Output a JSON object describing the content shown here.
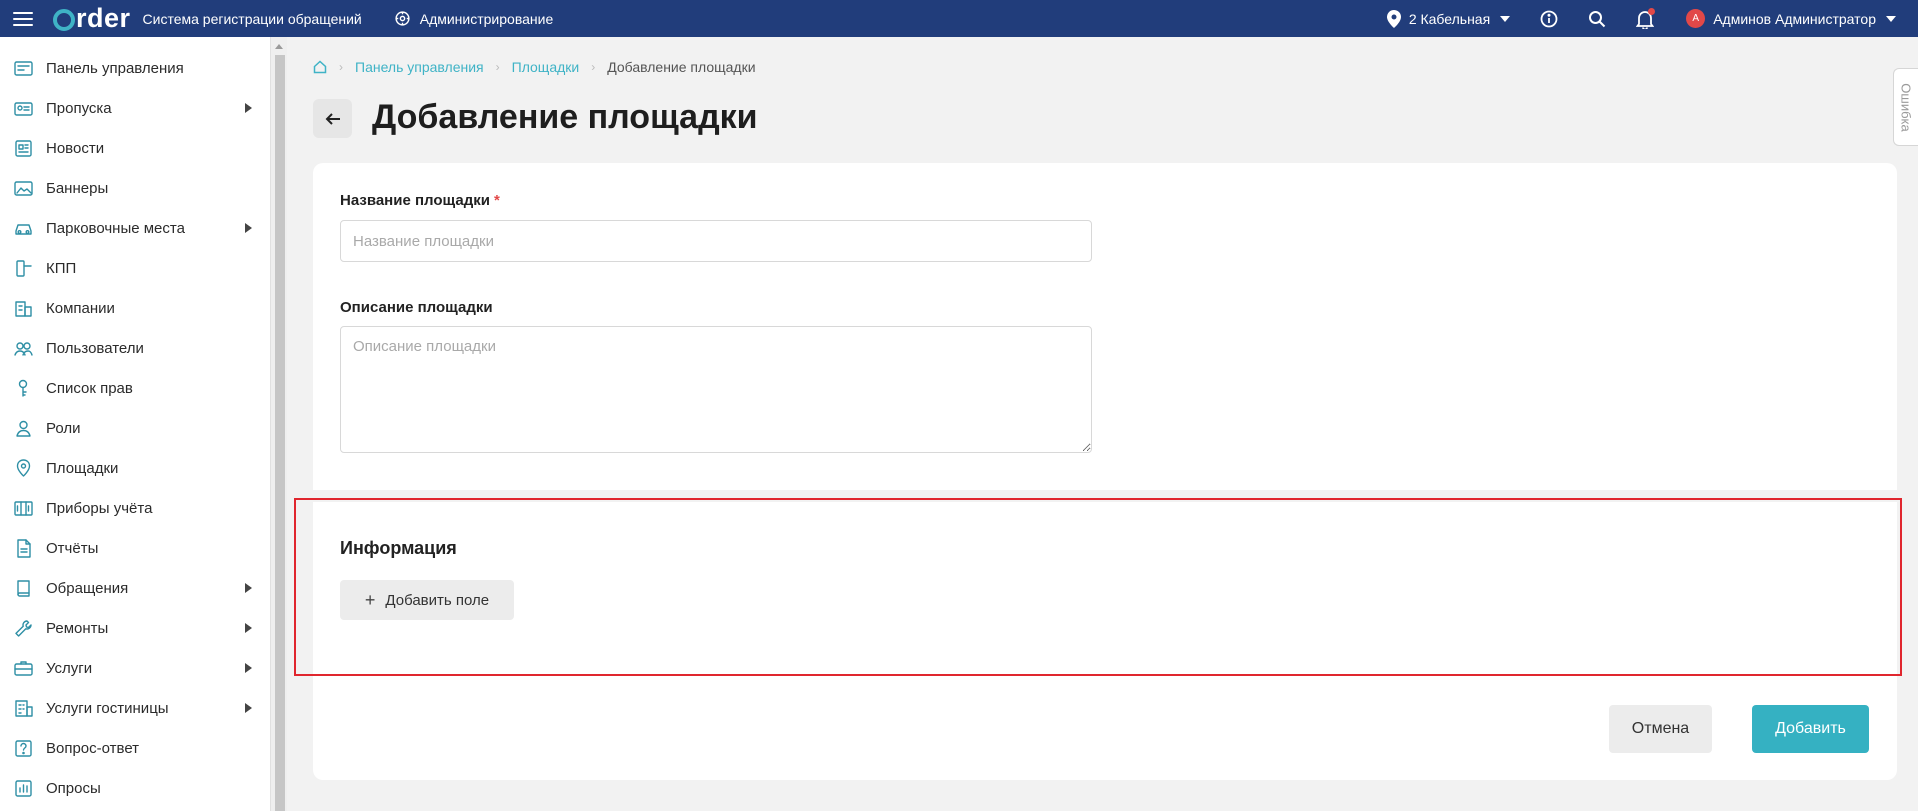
{
  "header": {
    "logo_text": "rder",
    "app_title": "Система регистрации обращений",
    "admin_label": "Администрирование",
    "location": "2 Кабельная",
    "user_name": "Админов Администратор",
    "avatar_letter": "А"
  },
  "sidebar": {
    "items": [
      {
        "label": "Панель управления",
        "icon": "dashboard-icon",
        "submenu": false
      },
      {
        "label": "Пропуска",
        "icon": "pass-card-icon",
        "submenu": true
      },
      {
        "label": "Новости",
        "icon": "news-icon",
        "submenu": false
      },
      {
        "label": "Баннеры",
        "icon": "image-icon",
        "submenu": false
      },
      {
        "label": "Парковочные места",
        "icon": "car-icon",
        "submenu": true
      },
      {
        "label": "КПП",
        "icon": "checkpoint-icon",
        "submenu": false
      },
      {
        "label": "Компании",
        "icon": "building-icon",
        "submenu": false
      },
      {
        "label": "Пользователи",
        "icon": "users-icon",
        "submenu": false
      },
      {
        "label": "Список прав",
        "icon": "key-icon",
        "submenu": false
      },
      {
        "label": "Роли",
        "icon": "user-icon",
        "submenu": false
      },
      {
        "label": "Площадки",
        "icon": "map-pin-icon",
        "submenu": false
      },
      {
        "label": "Приборы учёта",
        "icon": "meter-icon",
        "submenu": false
      },
      {
        "label": "Отчёты",
        "icon": "document-icon",
        "submenu": false
      },
      {
        "label": "Обращения",
        "icon": "book-icon",
        "submenu": true
      },
      {
        "label": "Ремонты",
        "icon": "wrench-icon",
        "submenu": true
      },
      {
        "label": "Услуги",
        "icon": "briefcase-icon",
        "submenu": true
      },
      {
        "label": "Услуги гостиницы",
        "icon": "hotel-icon",
        "submenu": true
      },
      {
        "label": "Вопрос-ответ",
        "icon": "question-icon",
        "submenu": false
      },
      {
        "label": "Опросы",
        "icon": "poll-icon",
        "submenu": false
      }
    ]
  },
  "breadcrumb": {
    "items": [
      "Панель управления",
      "Площадки"
    ],
    "current": "Добавление площадки"
  },
  "page": {
    "title": "Добавление площадки"
  },
  "form": {
    "name_label": "Название площадки",
    "name_required": "*",
    "name_placeholder": "Название площадки",
    "name_value": "",
    "description_label": "Описание площадки",
    "description_placeholder": "Описание площадки",
    "description_value": ""
  },
  "info": {
    "title": "Информация",
    "add_field_label": "Добавить поле"
  },
  "actions": {
    "cancel_label": "Отмена",
    "submit_label": "Добавить"
  },
  "error_tab": {
    "label": "Ошибка"
  },
  "colors": {
    "header_bg": "#213d7b",
    "accent": "#35b1c2",
    "highlight": "#e0262e",
    "required": "#e24848"
  }
}
